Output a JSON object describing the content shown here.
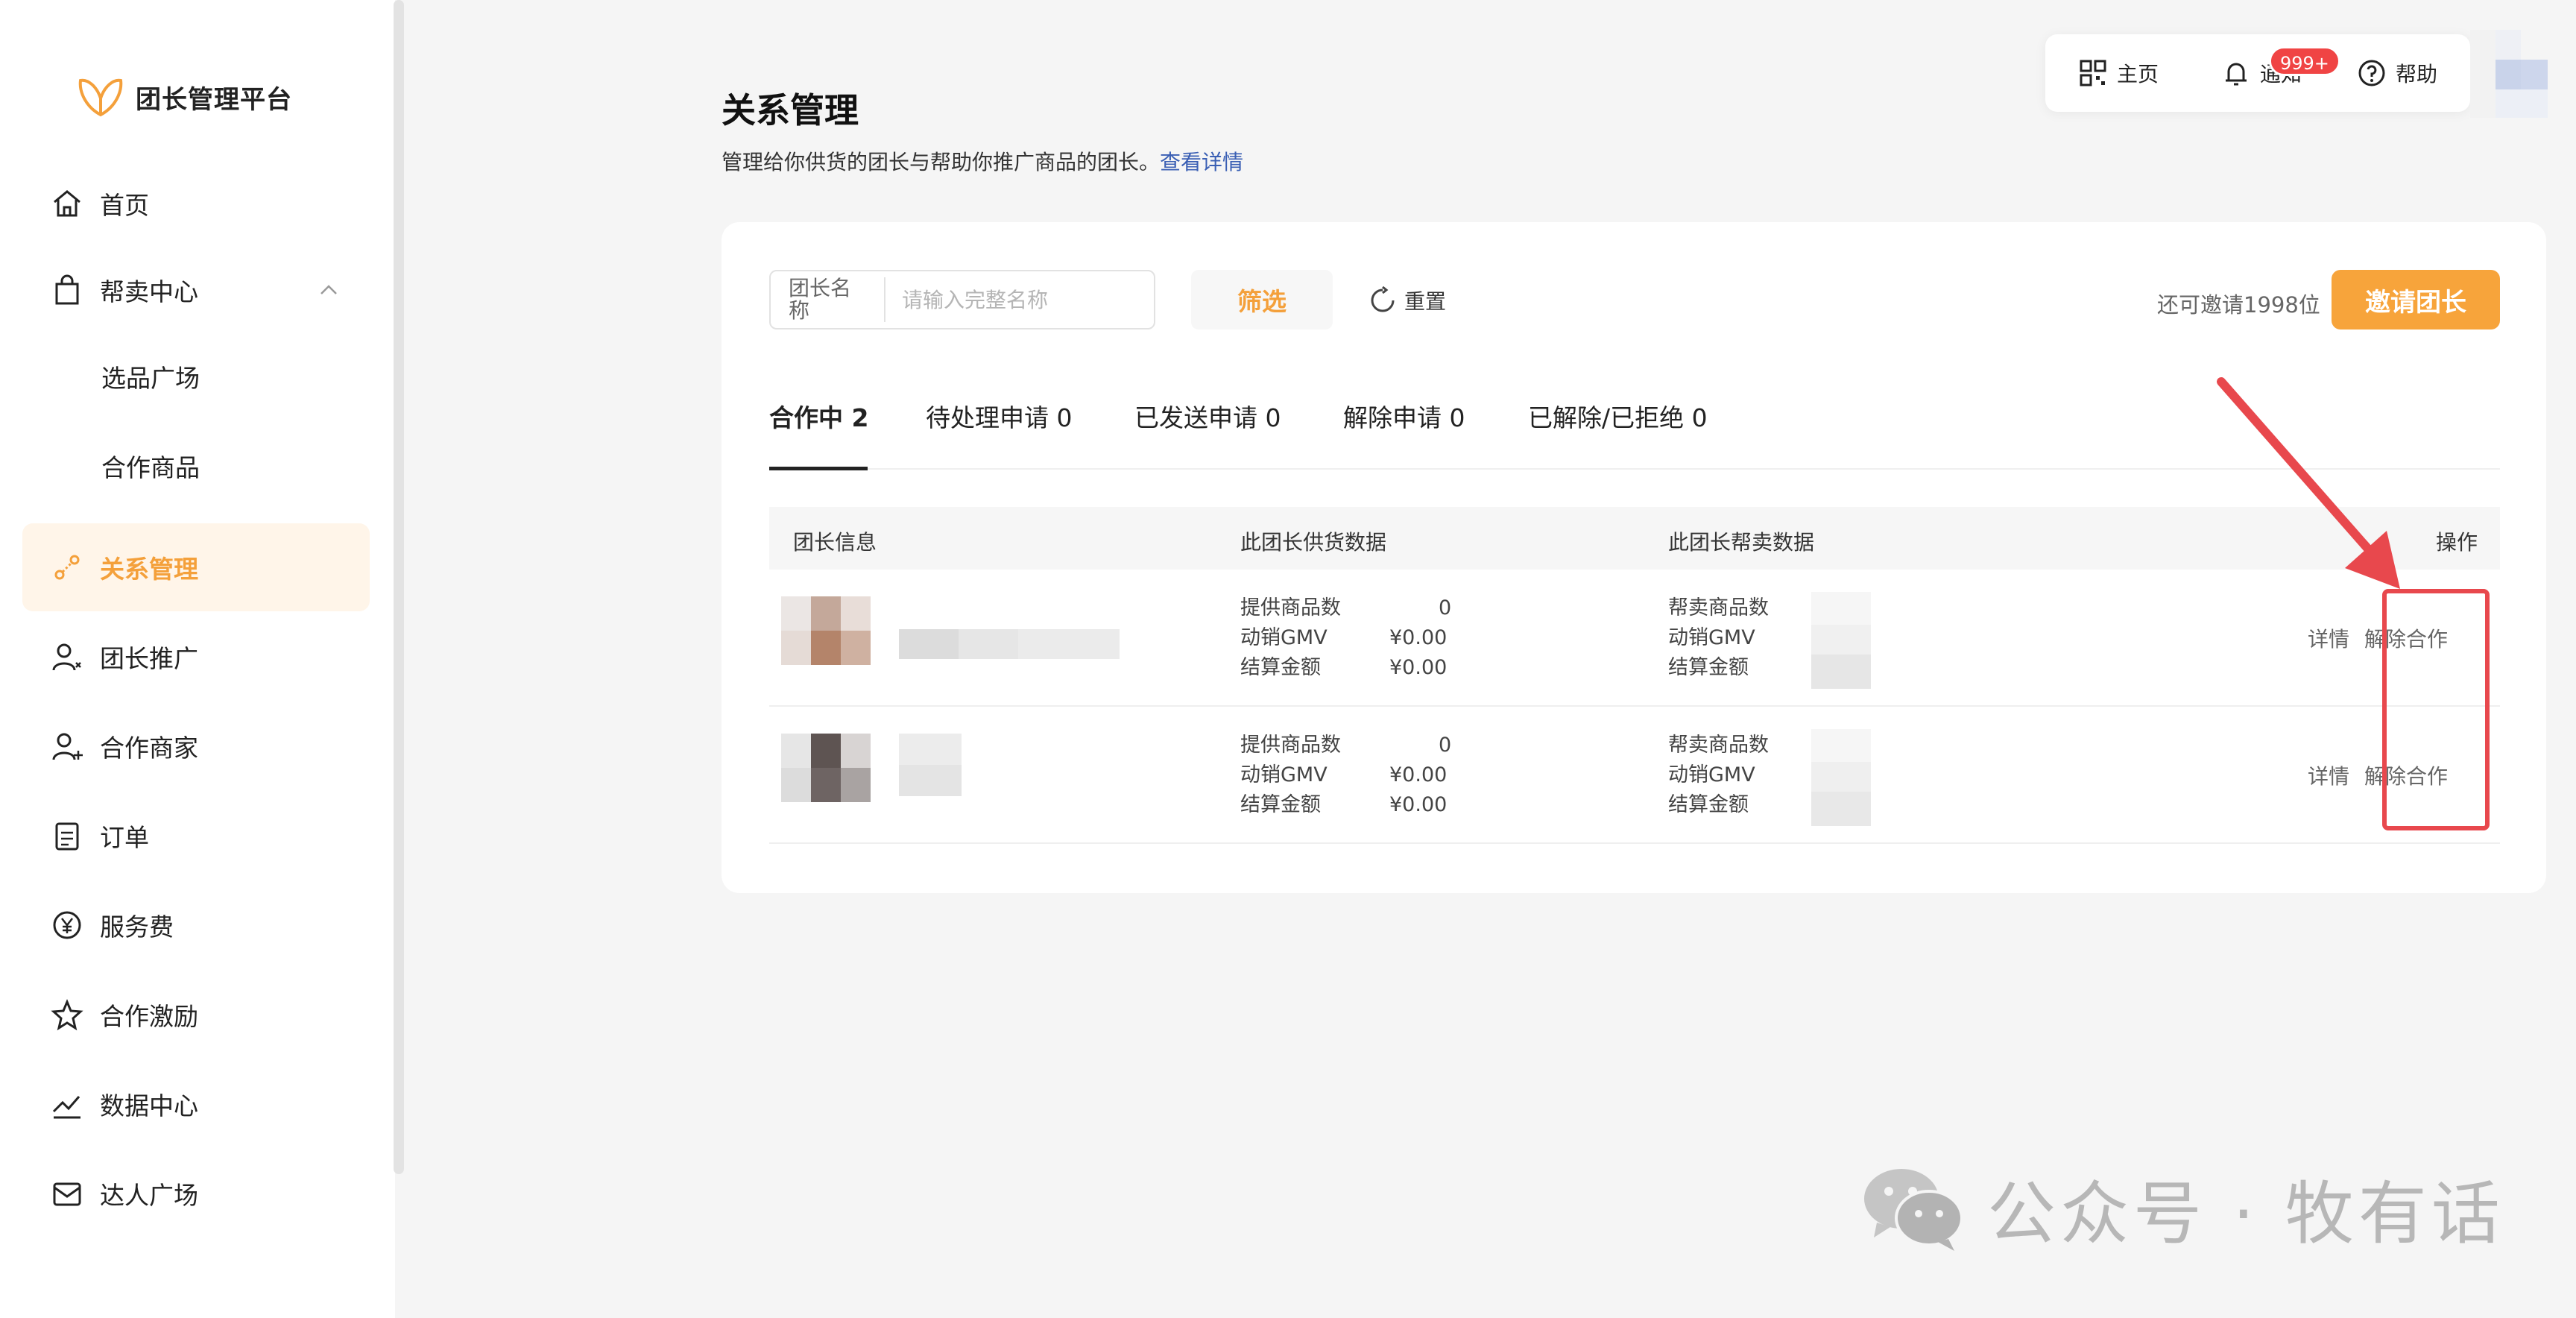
{
  "brand": {
    "name": "团长管理平台"
  },
  "sidebar": {
    "items": [
      {
        "label": "首页"
      },
      {
        "label": "帮卖中心"
      },
      {
        "label": "选品广场"
      },
      {
        "label": "合作商品"
      },
      {
        "label": "关系管理"
      },
      {
        "label": "团长推广"
      },
      {
        "label": "合作商家"
      },
      {
        "label": "订单"
      },
      {
        "label": "服务费"
      },
      {
        "label": "合作激励"
      },
      {
        "label": "数据中心"
      },
      {
        "label": "达人广场"
      }
    ]
  },
  "topbar": {
    "home": "主页",
    "notify": "通知",
    "badge": "999+",
    "help": "帮助"
  },
  "page": {
    "title": "关系管理",
    "desc": "管理给你供货的团长与帮助你推广商品的团长。",
    "desc_link": "查看详情"
  },
  "filter": {
    "name_label": "团长名称",
    "name_placeholder": "请输入完整名称",
    "filter_btn": "筛选",
    "reset_btn": "重置",
    "invite_count": "还可邀请1998位",
    "invite_btn": "邀请团长"
  },
  "tabs": [
    {
      "label": "合作中 2"
    },
    {
      "label": "待处理申请 0"
    },
    {
      "label": "已发送申请 0"
    },
    {
      "label": "解除申请 0"
    },
    {
      "label": "已解除/已拒绝 0"
    }
  ],
  "table": {
    "headers": {
      "info": "团长信息",
      "supply": "此团长供货数据",
      "help": "此团长帮卖数据",
      "op": "操作"
    },
    "supply_labels": [
      "提供商品数",
      "动销GMV",
      "结算金额"
    ],
    "help_labels": [
      "帮卖商品数",
      "动销GMV",
      "结算金额"
    ],
    "rows": [
      {
        "supply_values": [
          "0",
          "¥0.00",
          "¥0.00"
        ],
        "help_prefix": [
          "",
          "¥",
          "¥"
        ],
        "detail": "详情",
        "terminate": "解除合作"
      },
      {
        "supply_values": [
          "0",
          "¥0.00",
          "¥0.00"
        ],
        "help_prefix": [
          "",
          "¥",
          "¥"
        ],
        "detail": "详情",
        "terminate": "解除合作"
      }
    ]
  },
  "watermark": {
    "text": "公众号 · 牧有话"
  },
  "colors": {
    "accent": "#f4a03b",
    "highlight": "#e8484d",
    "link": "#3a5fb4"
  }
}
